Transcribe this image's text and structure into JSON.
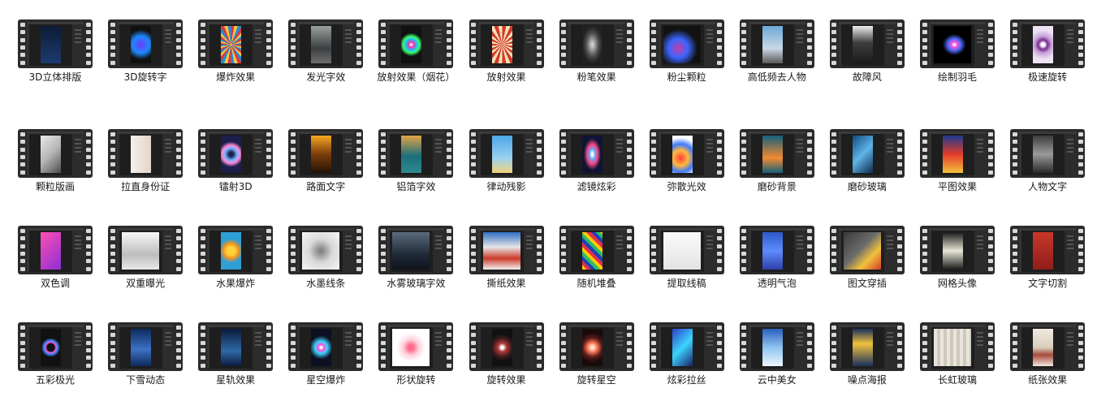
{
  "items": [
    {
      "label": "3D立体排版",
      "art": "linear-gradient(180deg,#0d1b35,#1d3b70)",
      "wide": false
    },
    {
      "label": "3D旋转字",
      "art": "radial-gradient(circle at 50% 50%,#6a3cff,#1e88ff 40%,#111 70%)",
      "wide": false
    },
    {
      "label": "爆炸效果",
      "art": "repeating-conic-gradient(#e0343f 0 10deg,#f6c93c 10deg 20deg,#1f8fd6 20deg 30deg)",
      "wide": false
    },
    {
      "label": "发光字效",
      "art": "linear-gradient(180deg,#9aa0a0,#3b3f41 60%,#6e6e6e)",
      "wide": false
    },
    {
      "label": "放射效果（烟花）",
      "art": "radial-gradient(circle,#ffffff 2%,#ff2fa0 12%,#19c0ff 26%,#3aff6a 38%,#111 55%)",
      "wide": false
    },
    {
      "label": "放射效果",
      "art": "repeating-conic-gradient(#d63828 0 12deg,#f3e1b8 12deg 24deg)",
      "wide": false
    },
    {
      "label": "粉笔效果",
      "art": "radial-gradient(ellipse at 50% 50%,#dddddd,#4a4a4a 45%,#222 70%)",
      "wide": false
    },
    {
      "label": "粉尘颗粒",
      "art": "radial-gradient(ellipse at 40% 60%,#c23fa6,#3a66ff 30%,#111 60%)",
      "wide": true
    },
    {
      "label": "高低频去人物",
      "art": "linear-gradient(180deg,#6aa8d8,#c9d9e6 60%,#5a5a5a)",
      "wide": false
    },
    {
      "label": "故障风",
      "art": "linear-gradient(180deg,#eeeeee,#3d3d3d 45%,#1b1b1b)",
      "wide": false
    },
    {
      "label": "绘制羽毛",
      "art": "radial-gradient(ellipse at 55% 50%,#ffffff 2%,#ff4fd8 10%,#4f6bff 22%,#000 40%)",
      "wide": true
    },
    {
      "label": "极速旋转",
      "art": "radial-gradient(circle,#ffffff 8%,#7b2a8f 22%,#c6a2d9 40%,#efe2f5 70%)",
      "wide": false
    },
    {
      "label": "颗粒版画",
      "art": "linear-gradient(135deg,#e9e9e9,#b5b5b5 50%,#4d4d4d)",
      "wide": false
    },
    {
      "label": "拉直身份证",
      "art": "linear-gradient(90deg,#f4f0ea,#e6d4c8)",
      "wide": false
    },
    {
      "label": "镭射3D",
      "art": "radial-gradient(circle,#1b1f4a 10%,#6fb4ff 28%,#ff8ad8 42%,#1b1f4a 60%)",
      "wide": false
    },
    {
      "label": "路面文字",
      "art": "linear-gradient(180deg,#f5a623,#7a3d0c 50%,#231307)",
      "wide": false
    },
    {
      "label": "铝箔字效",
      "art": "linear-gradient(180deg,#e3a347,#1b6f7b 55%,#2f8a8f)",
      "wide": false
    },
    {
      "label": "律动残影",
      "art": "linear-gradient(180deg,#4ba6e8,#9ad0f0 60%,#f2d37a)",
      "wide": false
    },
    {
      "label": "滤镜炫彩",
      "art": "radial-gradient(ellipse,#ffffff 5%,#5aa7ff 20%,#ff4d8b 35%,#101434 60%)",
      "wide": false
    },
    {
      "label": "弥散光效",
      "art": "radial-gradient(circle at 40% 60%,#ff3d3d,#ffb93d 30%,#3d7bff 55%,#ffffff 80%)",
      "wide": false
    },
    {
      "label": "磨砂背景",
      "art": "linear-gradient(180deg,#145f7d,#f28b30 60%,#145f7d)",
      "wide": false
    },
    {
      "label": "磨砂玻璃",
      "art": "linear-gradient(135deg,#0f4a7d,#5fb3e8 50%,#0f2a4d)",
      "wide": false
    },
    {
      "label": "平图效果",
      "art": "linear-gradient(180deg,#1b3a8c,#e33b2c 50%,#f4c23b)",
      "wide": false
    },
    {
      "label": "人物文字",
      "art": "linear-gradient(180deg,#3d3d3d,#9a9a9a 50%,#2a2a2a)",
      "wide": false
    },
    {
      "label": "双色调",
      "art": "linear-gradient(135deg,#ff4fb2,#8d2fd6)",
      "wide": false
    },
    {
      "label": "双重曝光",
      "art": "linear-gradient(180deg,#f7f7f7,#bdbdbd 60%,#e9e9e9)",
      "wide": true
    },
    {
      "label": "水果爆炸",
      "art": "radial-gradient(circle,#ffd23b 20%,#f7941d 35%,#2f9fd8 55%)",
      "wide": false
    },
    {
      "label": "水墨线条",
      "art": "radial-gradient(ellipse,#7a7a7a,#d9d9d9 45%,#f5f5f5)",
      "wide": true
    },
    {
      "label": "水雾玻璃字效",
      "art": "linear-gradient(180deg,#5b6b7c,#1f2a38 60%,#0f141c)",
      "wide": true
    },
    {
      "label": "撕纸效果",
      "art": "linear-gradient(180deg,#2f6fc4,#e5e5e5 40%,#cc3a2a 70%,#f2f2f2)",
      "wide": true
    },
    {
      "label": "随机堆叠",
      "art": "repeating-linear-gradient(45deg,#ffcc00 0 4px,#e8304a 4px 8px,#1f3fb8 8px 12px,#2dbb6b 12px 16px)",
      "wide": false
    },
    {
      "label": "提取线稿",
      "art": "linear-gradient(180deg,#fafafa,#e3e3e3)",
      "wide": true
    },
    {
      "label": "透明气泡",
      "art": "linear-gradient(180deg,#2d58c7,#5d8cff 50%,#2d3fa8)",
      "wide": false
    },
    {
      "label": "图文穿插",
      "art": "linear-gradient(135deg,#3a3a3a,#6b6b6b 45%,#f0c23c 70%,#d13a2d)",
      "wide": true
    },
    {
      "label": "网格头像",
      "art": "linear-gradient(180deg,#1a1a1a,#e7e7d5 50%,#1a1a1a)",
      "wide": false
    },
    {
      "label": "文字切割",
      "art": "linear-gradient(180deg,#c8372b,#8f1e18)",
      "wide": false
    },
    {
      "label": "五彩极光",
      "art": "radial-gradient(circle,#111 18%,#ff4fd8 24%,#3c8bff 32%,#111 45%)",
      "wide": false
    },
    {
      "label": "下雪动态",
      "art": "linear-gradient(180deg,#0d2a5c,#3d72c4 55%,#0d2a5c)",
      "wide": false
    },
    {
      "label": "星轨效果",
      "art": "linear-gradient(180deg,#0b1a3d,#2e6aa8 60%,#0b1a3d)",
      "wide": false
    },
    {
      "label": "星空爆炸",
      "art": "radial-gradient(circle,#ffffff 4%,#ff4fd8 14%,#3cd4ff 28%,#0c1022 55%)",
      "wide": false
    },
    {
      "label": "形状旋转",
      "art": "radial-gradient(circle,#ff6b8a 10%,#ffd1dc 30%,#ffffff 55%)",
      "wide": true
    },
    {
      "label": "旋转效果",
      "art": "radial-gradient(circle,#ffffff 6%,#b13a3a 20%,#3a1a1a 45%,#111 65%)",
      "wide": false
    },
    {
      "label": "旋转星空",
      "art": "radial-gradient(circle,#ffe6d1 6%,#ff7a59 22%,#5a1b1b 45%,#1a0a0a 70%)",
      "wide": false
    },
    {
      "label": "炫彩拉丝",
      "art": "linear-gradient(135deg,#2d3fc7,#3cd4ff 50%,#1b1f6b)",
      "wide": false
    },
    {
      "label": "云中美女",
      "art": "linear-gradient(180deg,#2a5fbf,#8fc4f0 50%,#eef6ff)",
      "wide": false
    },
    {
      "label": "噪点海报",
      "art": "linear-gradient(180deg,#18305c,#f0c23c 40%,#18305c)",
      "wide": false
    },
    {
      "label": "长虹玻璃",
      "art": "repeating-linear-gradient(90deg,#e9e5dd 0 4px,#cfc9bd 4px 8px)",
      "wide": true
    },
    {
      "label": "纸张效果",
      "art": "linear-gradient(180deg,#f1e9df,#d9cdbd 50%,#a64b3b 70%,#f1e9df)",
      "wide": false
    }
  ]
}
